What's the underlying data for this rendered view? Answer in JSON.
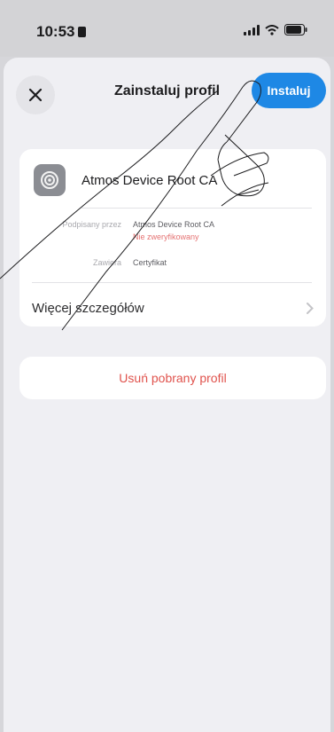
{
  "status_bar": {
    "time": "10:53",
    "network": "signal-icon",
    "wifi": "wifi-icon",
    "battery": "battery-icon"
  },
  "header": {
    "close_icon": "close-icon",
    "title": "Zainstaluj profil",
    "install_label": "Instaluj"
  },
  "profile": {
    "icon": "gear-icon",
    "name": "Atmos Device Root CA",
    "details": [
      {
        "label": "Podpisany przez",
        "values": [
          "Atmos Device Root CA",
          "Nie zweryfikowany"
        ]
      },
      {
        "label": "Zawiera",
        "values": [
          "Certyfikat"
        ]
      }
    ],
    "more_label": "Więcej szczegółów"
  },
  "remove_label": "Usuń pobrany profil",
  "colors": {
    "accent": "#1e88e5",
    "danger": "#e0534d",
    "background": "#efeff3"
  }
}
